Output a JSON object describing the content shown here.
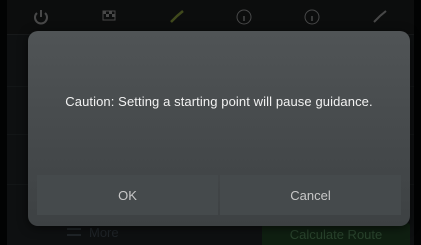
{
  "toolbar": {
    "icons": [
      "power-icon",
      "checkered-flag-icon",
      "route-icon",
      "info-icon",
      "info-icon",
      "route-icon"
    ]
  },
  "bottom_bar": {
    "more_label": "More",
    "calculate_label": "Calculate Route"
  },
  "dialog": {
    "message": "Caution: Setting a starting point will pause guidance.",
    "ok_label": "OK",
    "cancel_label": "Cancel"
  },
  "colors": {
    "dialog_bg": "#4a4e50",
    "button_bg": "#454a4c",
    "text": "#f2f2f2",
    "accent_green": "#c5e04a"
  }
}
